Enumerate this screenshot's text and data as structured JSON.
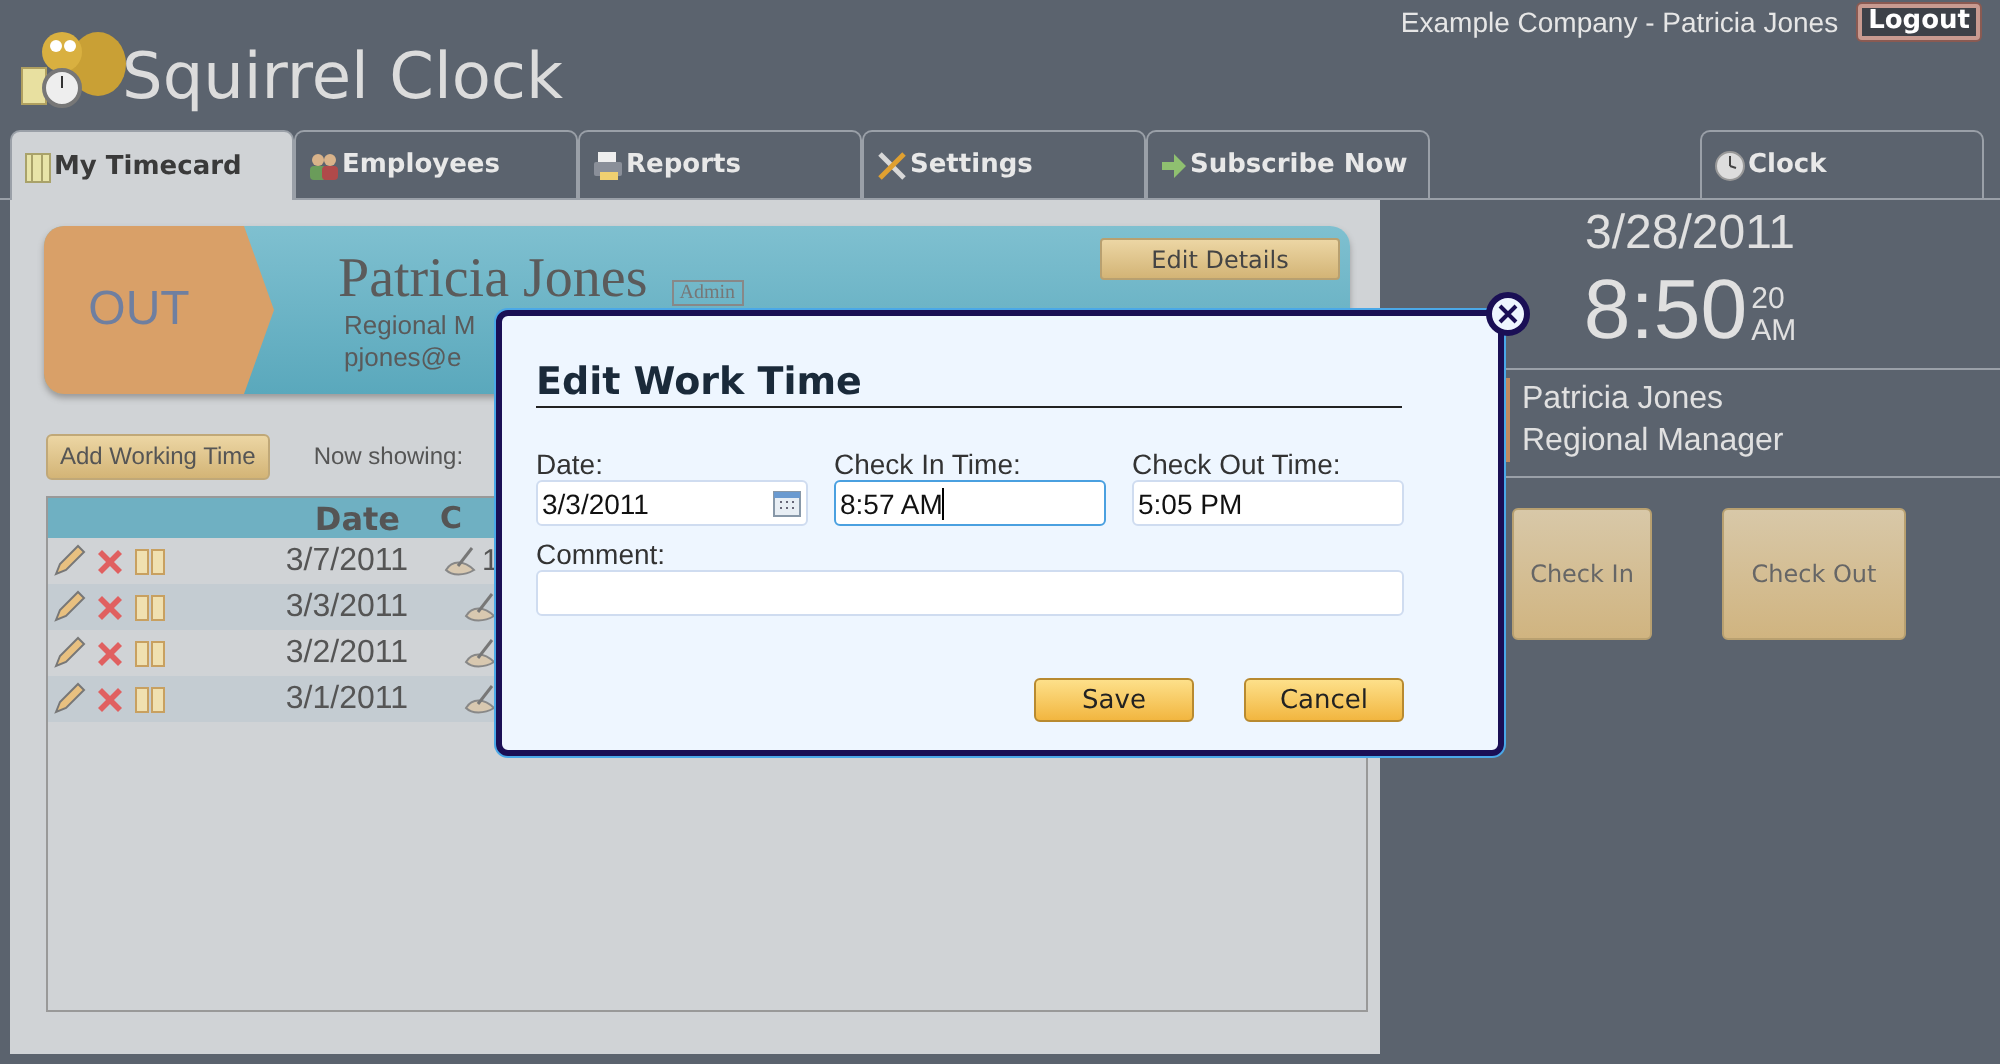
{
  "header": {
    "app_name": "Squirrel Clock",
    "account": "Example Company - Patricia Jones",
    "logout": "Logout"
  },
  "tabs": [
    {
      "label": "My Timecard",
      "kind": "timecard",
      "selected": true
    },
    {
      "label": "Employees",
      "kind": "people",
      "selected": false
    },
    {
      "label": "Reports",
      "kind": "printer",
      "selected": false
    },
    {
      "label": "Settings",
      "kind": "tools",
      "selected": false
    },
    {
      "label": "Subscribe Now",
      "kind": "arrow",
      "selected": false
    },
    {
      "label": "Clock",
      "kind": "clock",
      "selected": false
    }
  ],
  "status_banner": {
    "status": "OUT",
    "name": "Patricia Jones",
    "role_badge": "Admin",
    "title": "Regional M",
    "email": "pjones@e",
    "edit_button": "Edit Details"
  },
  "toolbar": {
    "add_button": "Add Working Time",
    "filter_label": "Now showing:"
  },
  "timecard": {
    "columns": [
      "Date",
      "C"
    ],
    "rows": [
      {
        "date": "3/7/2011",
        "column_2": "1"
      },
      {
        "date": "3/3/2011"
      },
      {
        "date": "3/2/2011"
      },
      {
        "date": "3/1/2011"
      }
    ]
  },
  "clock": {
    "date": "3/28/2011",
    "time": "8:50",
    "seconds": "20",
    "meridiem": "AM",
    "name": "Patricia Jones",
    "title": "Regional Manager",
    "buttons": [
      "Check In",
      "Check Out"
    ]
  },
  "dialog": {
    "title": "Edit Work Time",
    "fields": [
      {
        "label": "Date:",
        "value": "3/3/2011",
        "kind": "date",
        "focused": false
      },
      {
        "label": "Check In Time:",
        "value": "8:57 AM",
        "kind": "time",
        "focused": true
      },
      {
        "label": "Check Out Time:",
        "value": "5:05 PM",
        "kind": "time",
        "focused": false
      },
      {
        "label": "Comment:",
        "kind": "comment",
        "focused": false
      }
    ],
    "buttons": [
      "Save",
      "Cancel"
    ]
  }
}
